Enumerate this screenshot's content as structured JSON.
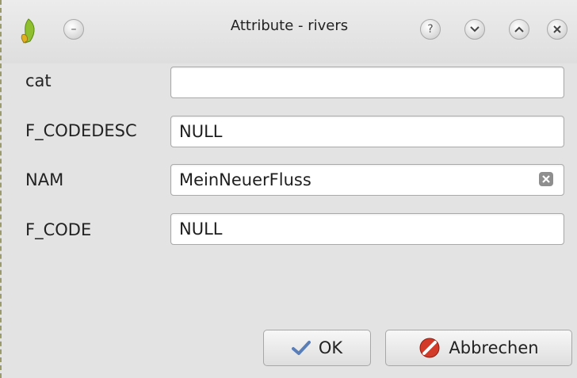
{
  "window": {
    "title": "Attribute - rivers",
    "controls": {
      "help": "?",
      "minimize": "⌄",
      "maximize": "⌃",
      "close": "✕"
    }
  },
  "fields": [
    {
      "label": "cat",
      "value": ""
    },
    {
      "label": "F_CODEDESC",
      "value": "NULL"
    },
    {
      "label": "NAM",
      "value": "MeinNeuerFluss"
    },
    {
      "label": "F_CODE",
      "value": "NULL"
    }
  ],
  "buttons": {
    "ok_label": "OK",
    "cancel_label": "Abbrechen"
  },
  "colors": {
    "ok_check": "#5a7fb8",
    "cancel_red": "#d23a2a"
  },
  "icons": [
    "qgis-logo-icon",
    "menu-circle-icon",
    "help-icon",
    "minimize-icon",
    "maximize-icon",
    "close-icon",
    "clear-text-icon",
    "checkmark-icon",
    "cancel-icon"
  ]
}
